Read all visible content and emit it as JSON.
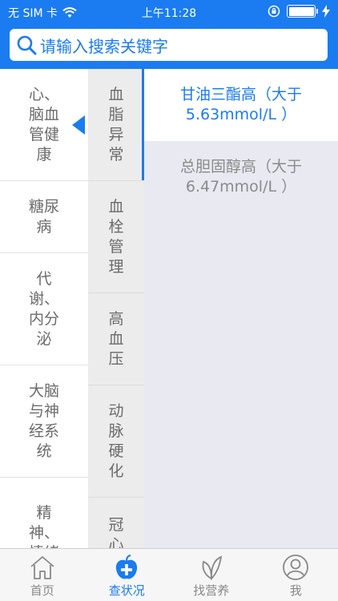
{
  "status": {
    "carrier": "无 SIM 卡",
    "time": "上午11:28"
  },
  "search": {
    "placeholder": "请输入搜索关键字"
  },
  "col1": {
    "items": [
      {
        "label": "心、脑血管健康",
        "active": true
      },
      {
        "label": "糖尿病"
      },
      {
        "label": "代谢、内分泌"
      },
      {
        "label": "大脑与神经系统"
      },
      {
        "label": "精神、情绪"
      }
    ]
  },
  "col2": {
    "items": [
      {
        "label": "血脂异常",
        "active": true
      },
      {
        "label": "血栓管理"
      },
      {
        "label": "高血压"
      },
      {
        "label": "动脉硬化"
      },
      {
        "label": "冠心"
      }
    ]
  },
  "col3": {
    "items": [
      {
        "label": "甘油三酯高（大于5.63mmol/L ）",
        "active": true
      },
      {
        "label": "总胆固醇高（大于6.47mmol/L ）"
      }
    ]
  },
  "tabbar": {
    "items": [
      {
        "label": "首页",
        "icon": "home-icon"
      },
      {
        "label": "查状况",
        "icon": "apple-plus-icon",
        "active": true
      },
      {
        "label": "找营养",
        "icon": "leaf-icon"
      },
      {
        "label": "我",
        "icon": "user-icon"
      }
    ]
  },
  "colors": {
    "accent": "#1a7cf0",
    "panel": "#e8e9f1"
  }
}
